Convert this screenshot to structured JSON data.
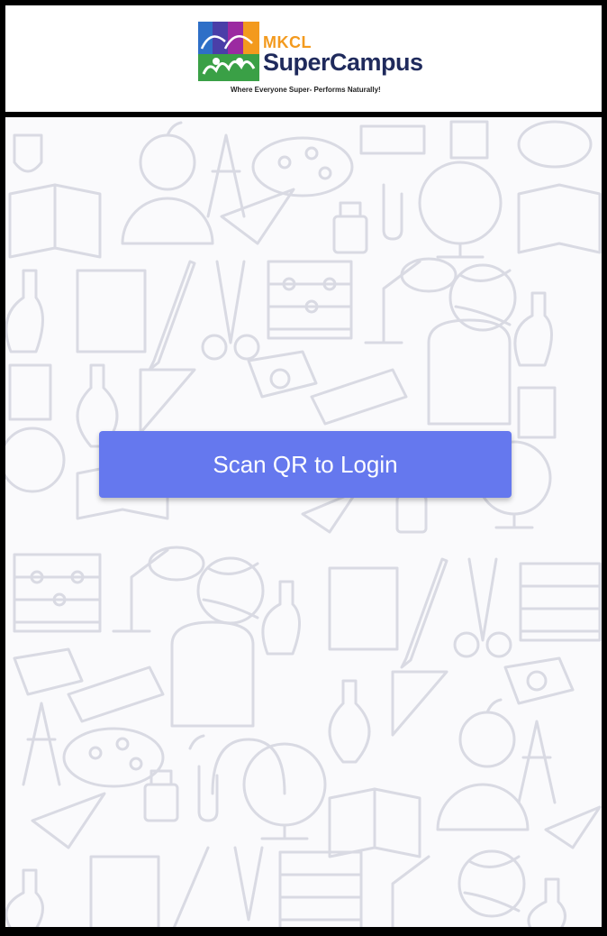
{
  "header": {
    "logo": {
      "brand_small": "MKCL",
      "brand_name": "SuperCampus",
      "tagline": "Where Everyone Super- Performs Naturally!"
    }
  },
  "main": {
    "scan_button_label": "Scan QR to Login",
    "background_pattern": "school-supplies-doodle-pattern"
  },
  "colors": {
    "primary_button": "#6578ee",
    "brand_orange": "#f39a1e",
    "brand_navy": "#1f2a5c",
    "background": "#fafafc",
    "doodle_stroke": "#d9dae3"
  }
}
